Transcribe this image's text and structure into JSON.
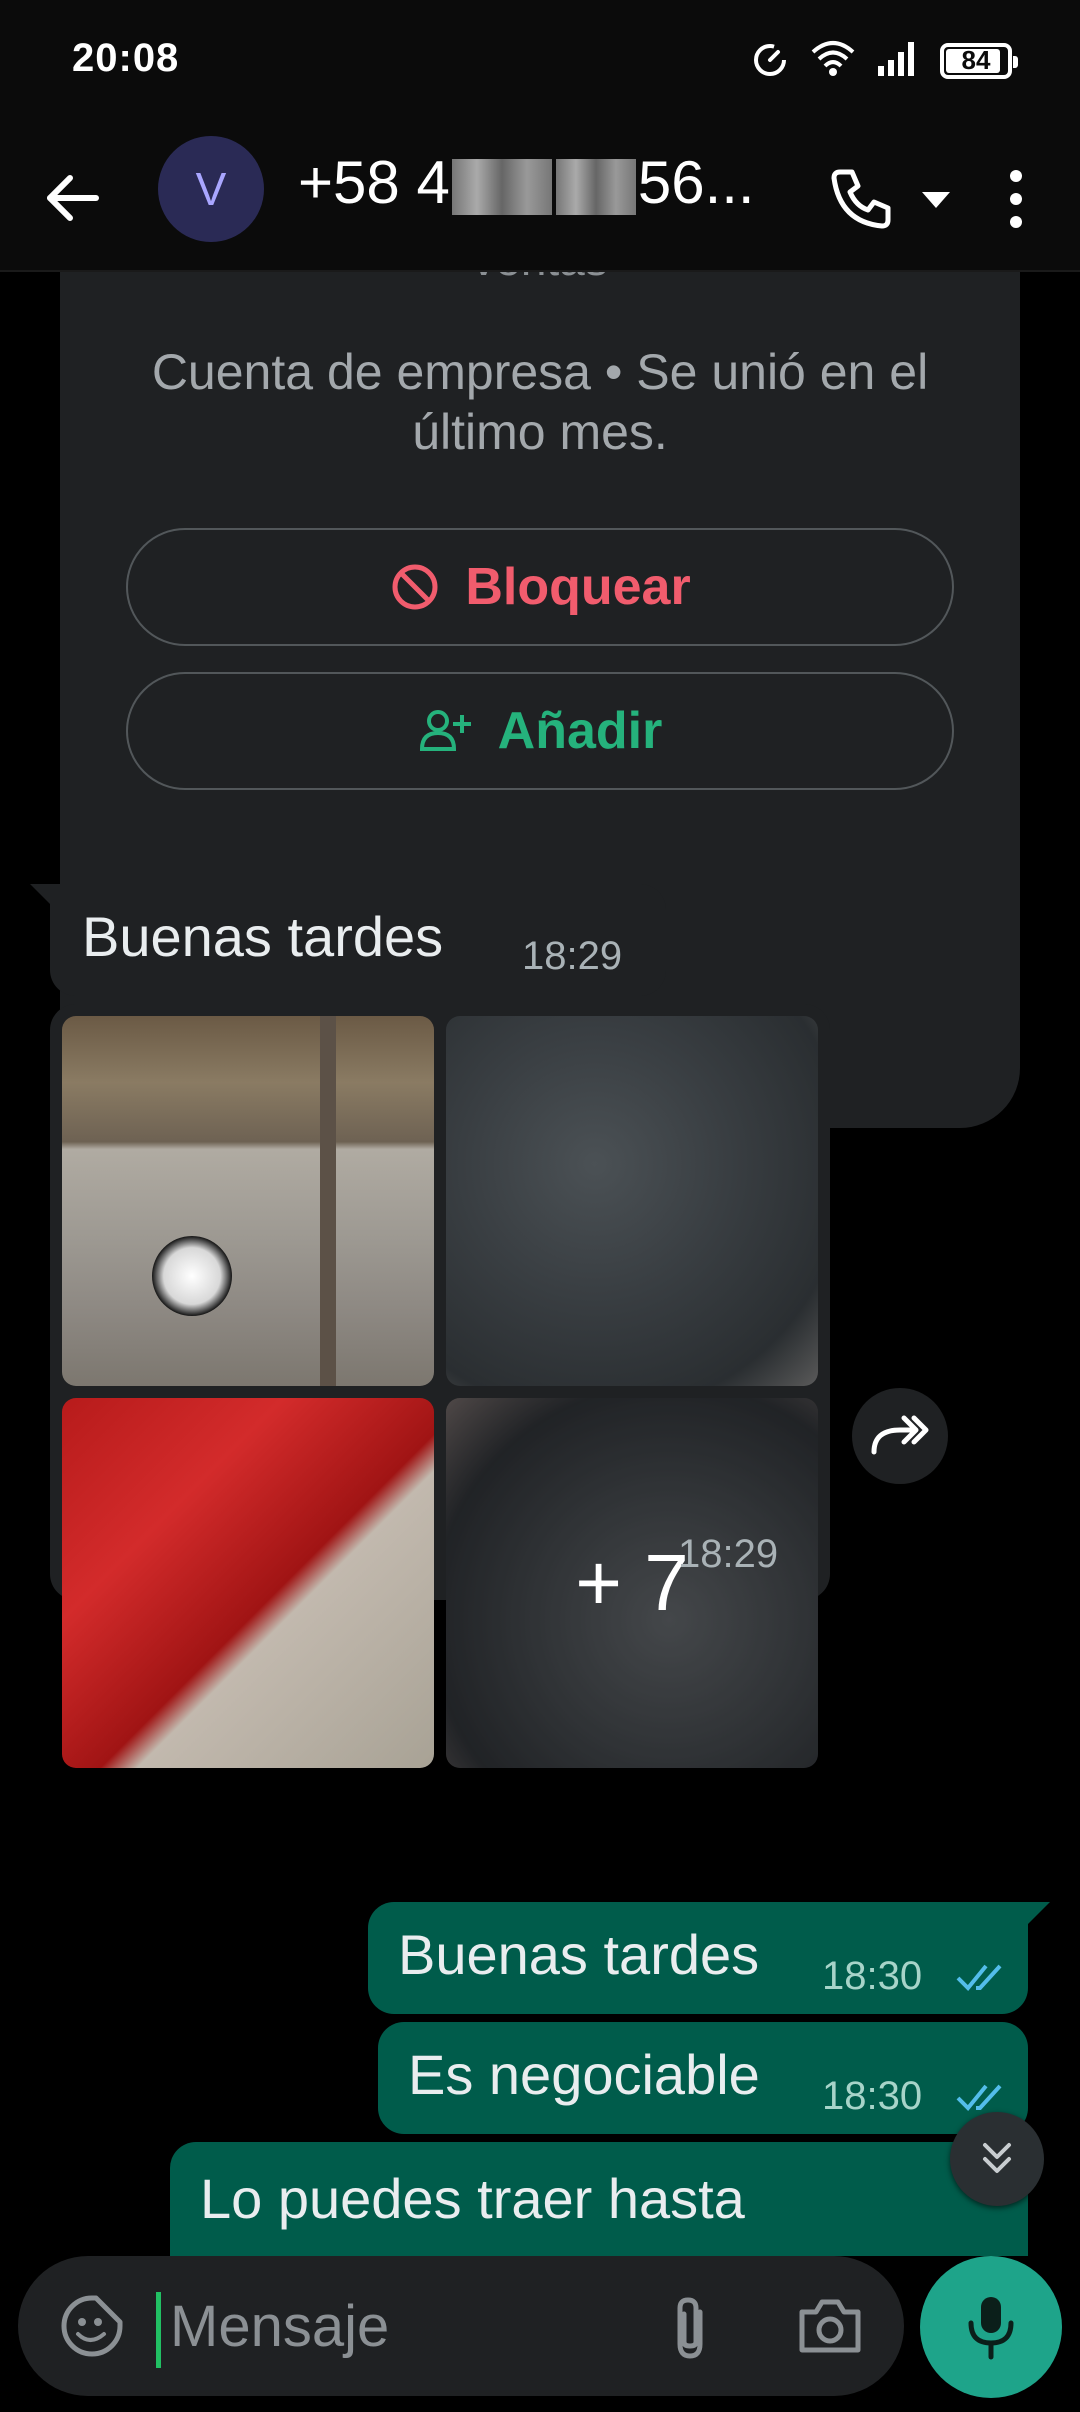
{
  "status_bar": {
    "time": "20:08",
    "battery": "84",
    "battery_fraction": 0.84
  },
  "header": {
    "avatar_initial": "V",
    "contact_prefix": "+58 4",
    "contact_suffix": "56..."
  },
  "info_card": {
    "top_text": "ventas",
    "subtitle": "Cuenta de empresa • Se unió en el último mes.",
    "block_label": "Bloquear",
    "add_label": "Añadir"
  },
  "messages": {
    "m1": {
      "text": "Buenas tardes",
      "time": "18:29"
    },
    "album": {
      "more": "+ 7",
      "time": "18:29"
    },
    "m2": {
      "text": "Buenas tardes",
      "time": "18:30"
    },
    "m3": {
      "text": "Es negociable",
      "time": "18:30"
    },
    "m4": {
      "text": "Lo puedes traer hasta"
    }
  },
  "input_bar": {
    "placeholder": "Mensaje"
  },
  "colors": {
    "accent": "#21c063",
    "outgoing_bubble": "#005c4b",
    "incoming_bubble": "#1f2123",
    "block_red": "#f15c6d",
    "read_ticks": "#53bdeb"
  }
}
